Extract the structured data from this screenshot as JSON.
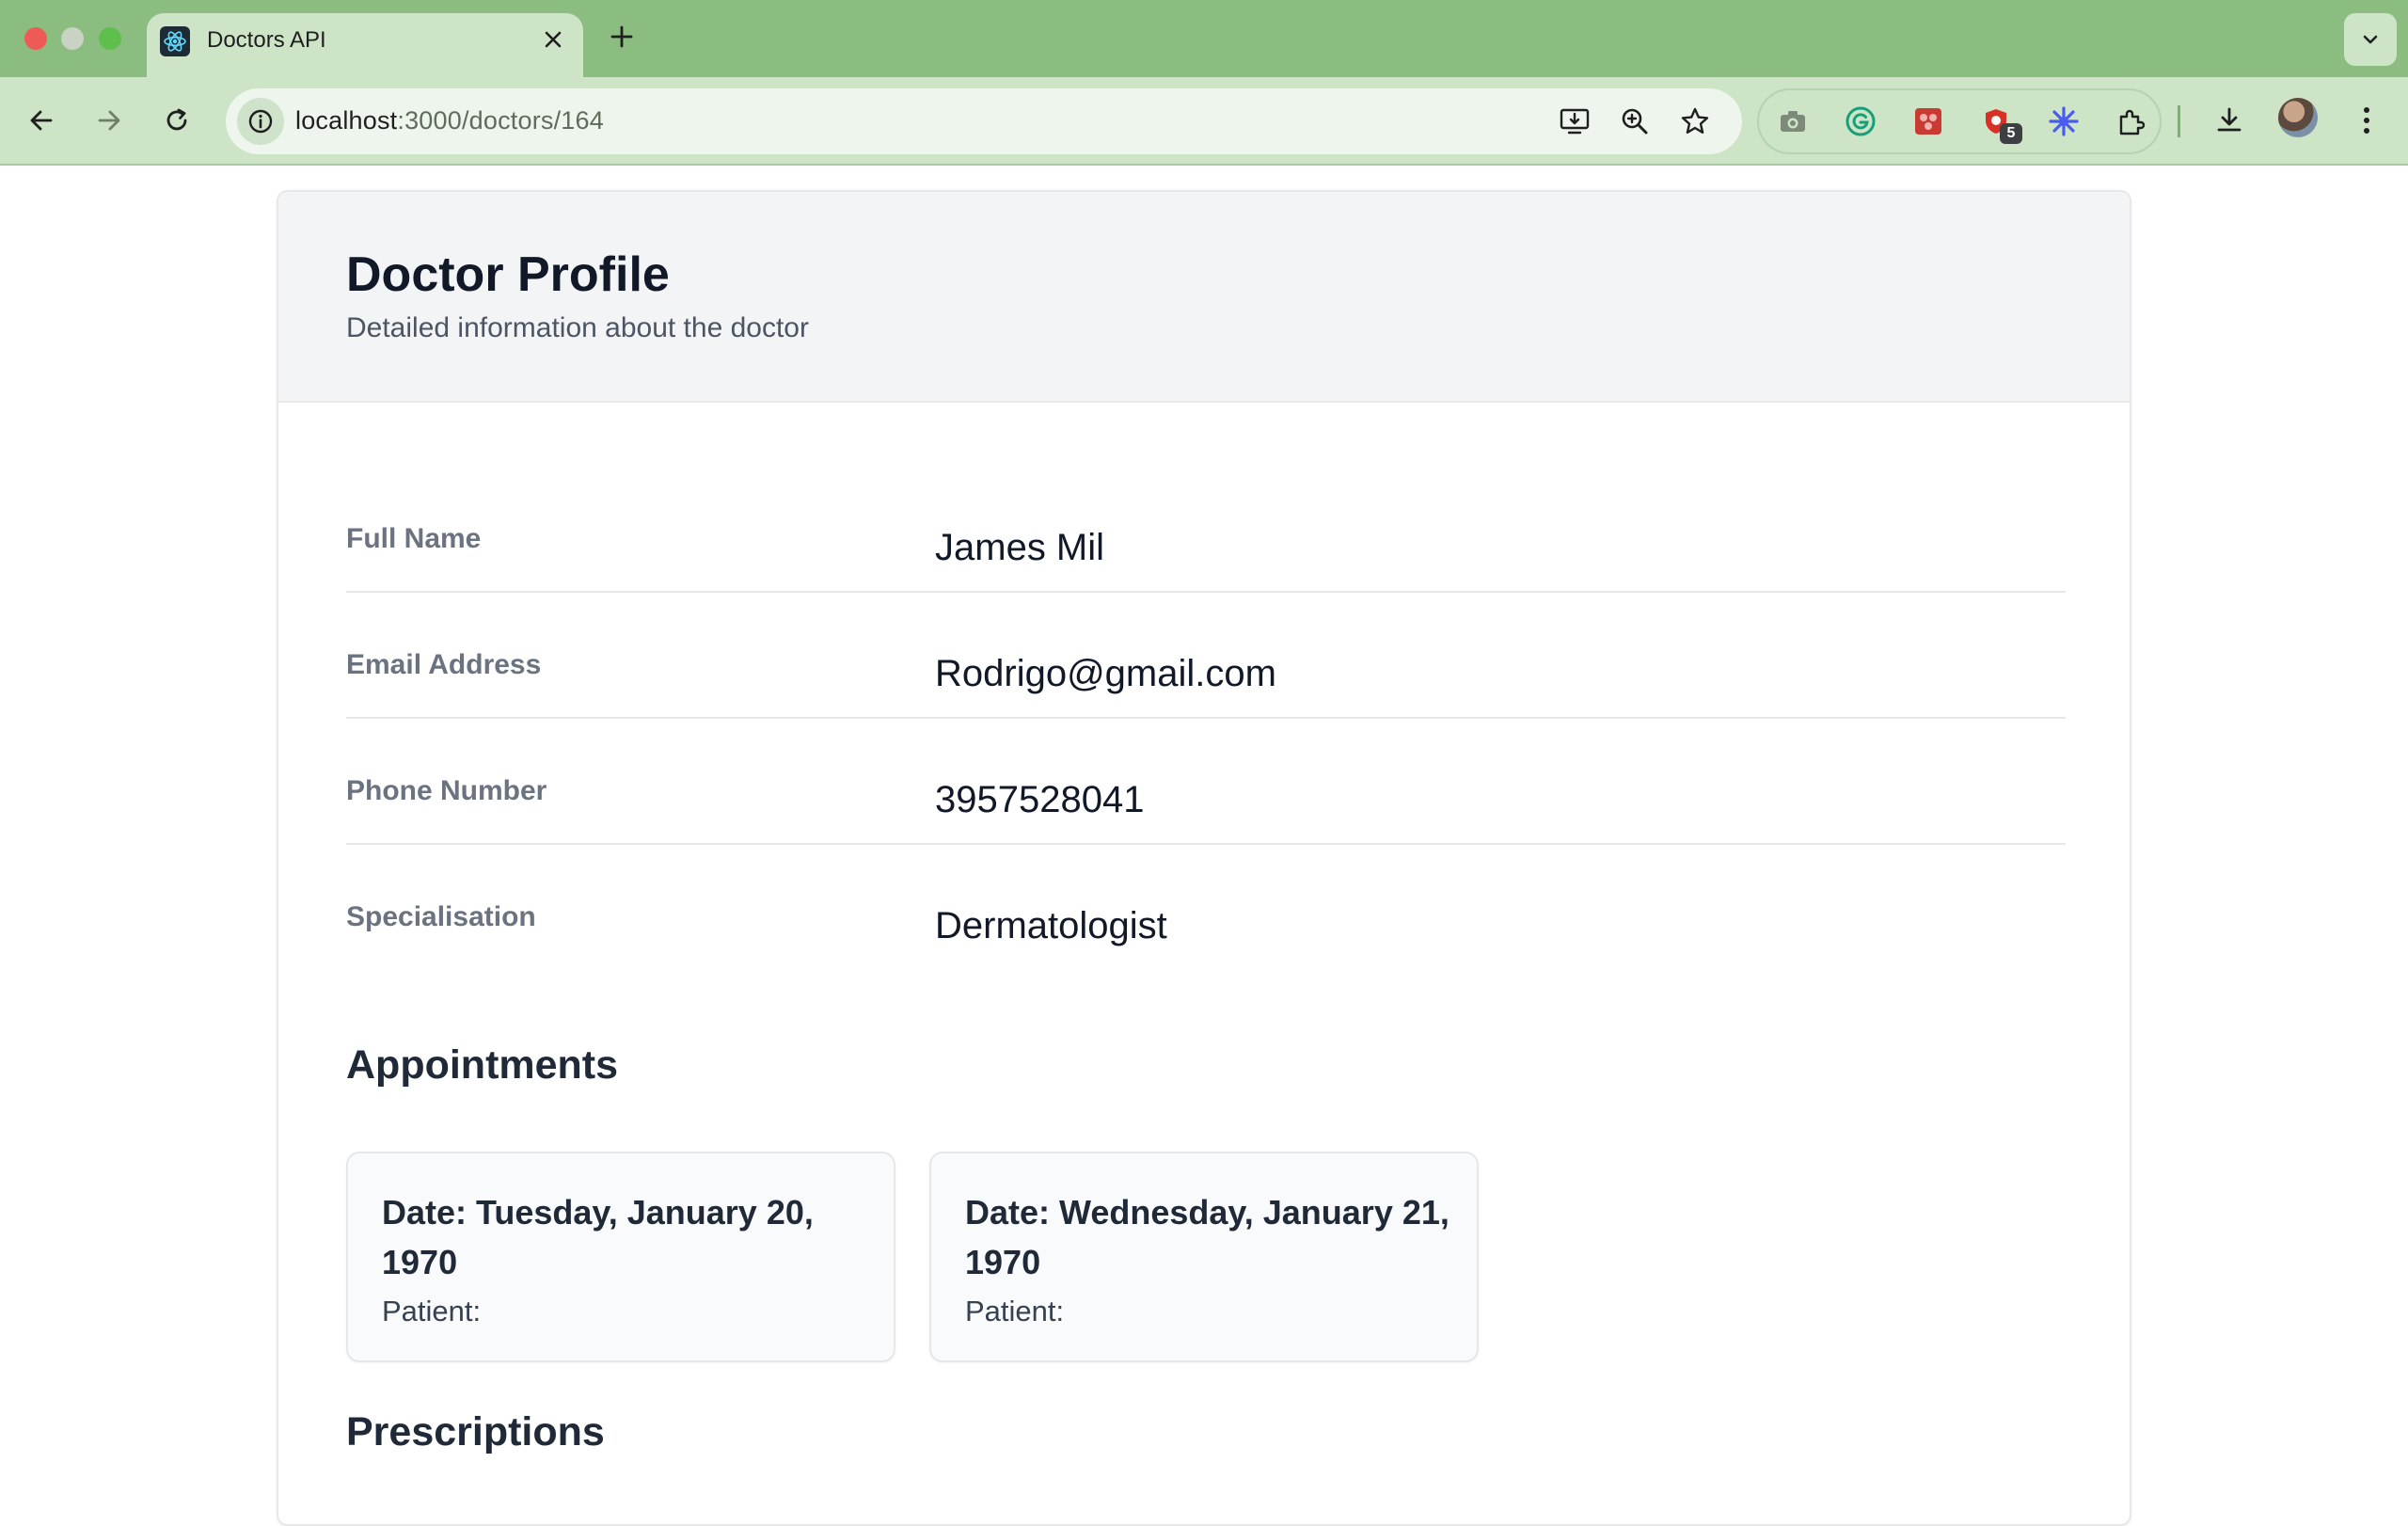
{
  "browser": {
    "tab_title": "Doctors API",
    "url_host": "localhost",
    "url_rest": ":3000/doctors/164",
    "extension_badge": "5"
  },
  "profile": {
    "title": "Doctor Profile",
    "subtitle": "Detailed information about the doctor",
    "fields": [
      {
        "label": "Full Name",
        "value": "James Mil"
      },
      {
        "label": "Email Address",
        "value": "Rodrigo@gmail.com"
      },
      {
        "label": "Phone Number",
        "value": "3957528041"
      },
      {
        "label": "Specialisation",
        "value": "Dermatologist"
      }
    ]
  },
  "appointments": {
    "heading": "Appointments",
    "items": [
      {
        "date": "Date: Tuesday, January 20, 1970",
        "patient": "Patient:"
      },
      {
        "date": "Date: Wednesday, January 21, 1970",
        "patient": "Patient:"
      }
    ]
  },
  "prescriptions": {
    "heading": "Prescriptions"
  }
}
